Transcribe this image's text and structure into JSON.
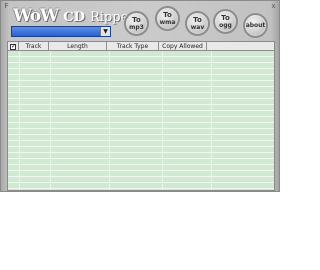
{
  "app": {
    "logo_wow": "WoW",
    "logo_cd": "CD",
    "logo_ripper": "Ripper",
    "window_left_glyph": "F",
    "window_right_glyph": "x"
  },
  "drive_select": {
    "selected": "",
    "arrow_icon": "chevron-down-icon"
  },
  "buttons": [
    {
      "top": "To",
      "bottom": "mp3"
    },
    {
      "top": "To",
      "bottom": "wma"
    },
    {
      "top": "To",
      "bottom": "wav"
    },
    {
      "top": "To",
      "bottom": "ogg"
    },
    {
      "top": "about",
      "bottom": ""
    }
  ],
  "table": {
    "columns": [
      "Track",
      "Length",
      "Track Type",
      "Copy Allowed"
    ],
    "rows": []
  },
  "colors": {
    "table_background": "#cfead1",
    "drive_select": "#2a62cf",
    "window": "#c8c8c8"
  }
}
